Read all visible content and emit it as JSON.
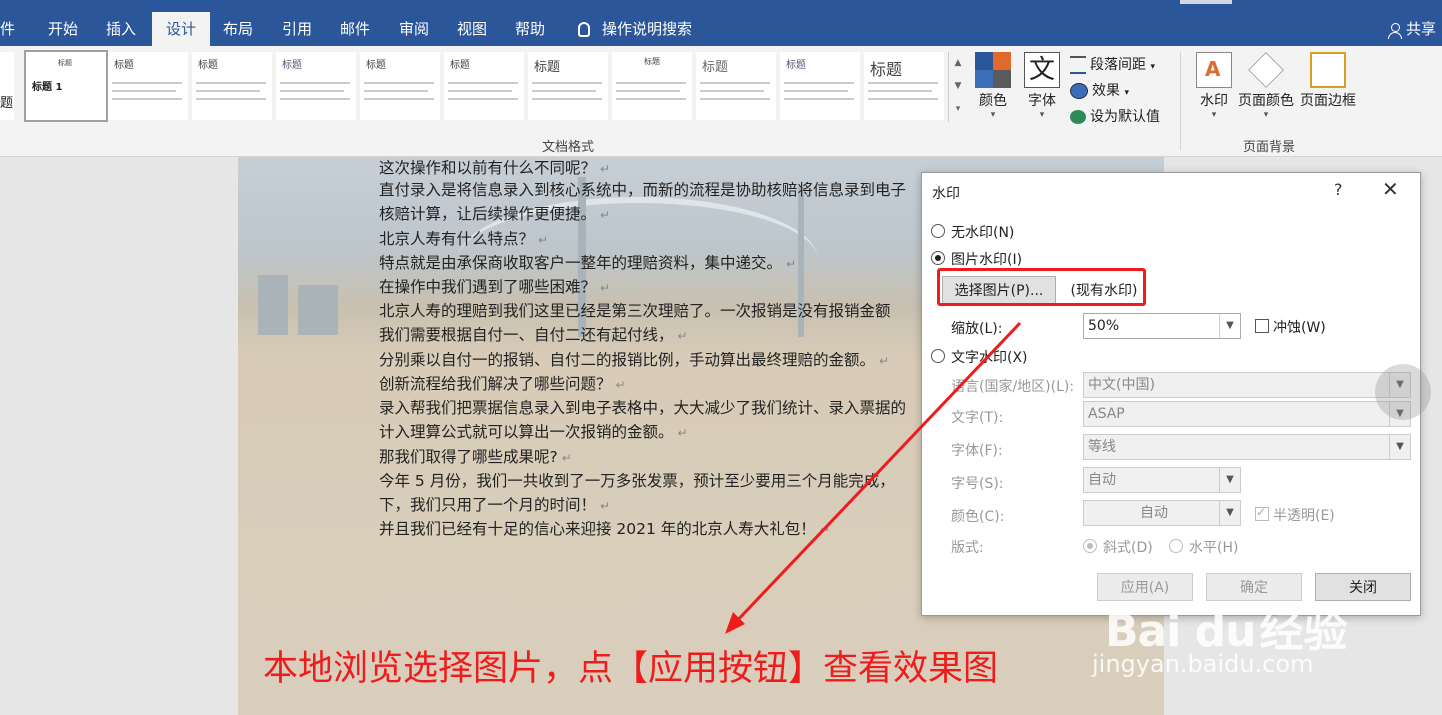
{
  "tabs": {
    "file": "件",
    "home": "开始",
    "insert": "插入",
    "design": "设计",
    "layout": "布局",
    "refs": "引用",
    "mail": "邮件",
    "review": "审阅",
    "view": "视图",
    "help": "帮助",
    "tellme": "操作说明搜索",
    "share": "共享"
  },
  "ribbon": {
    "gallery_partial": "题",
    "gallery_selected_title": "标题 1",
    "gallery_titles": [
      "标题",
      "标题",
      "标题",
      "标题",
      "标题",
      "标题",
      "标题",
      "标题",
      "标题",
      "标题"
    ],
    "group_docformat": "文档格式",
    "colors": "颜色",
    "fonts": "字体",
    "fonts_glyph": "文",
    "para_spacing": "段落间距",
    "effects": "效果",
    "set_default": "设为默认值",
    "watermark": "水印",
    "page_color": "页面颜色",
    "page_border": "页面边框",
    "group_pagebg": "页面背景"
  },
  "document": {
    "lines": [
      "这次操作和以前有什么不同呢？",
      "直付录入是将信息录入到核心系统中，而新的流程是协助核赔将信息录到电子",
      "核赔计算，让后续操作更便捷。",
      "北京人寿有什么特点？",
      "特点就是由承保商收取客户一整年的理赔资料，集中递交。",
      "在操作中我们遇到了哪些困难？",
      "北京人寿的理赔到我们这里已经是第三次理赔了。一次报销是没有报销金额",
      "我们需要根据自付一、自付二还有起付线，",
      "分别乘以自付一的报销、自付二的报销比例，手动算出最终理赔的金额。",
      "创新流程给我们解决了哪些问题？",
      "录入帮我们把票据信息录入到电子表格中，大大减少了我们统计、录入票据的",
      "计入理算公式就可以算出一次报销的金额。",
      "那我们取得了哪些成果呢?",
      "今年  5  月份，我们一共收到了一万多张发票，预计至少要用三个月能完成，",
      "下，我们只用了一个月的时间！",
      "并且我们已经有十足的信心来迎接 2021 年的北京人寿大礼包！"
    ],
    "para_mark": "↵"
  },
  "dialog": {
    "title": "水印",
    "help": "?",
    "close": "✕",
    "no_watermark": "无水印(N)",
    "picture_watermark": "图片水印(I)",
    "select_picture": "选择图片(P)...",
    "existing_watermark": "(现有水印)",
    "scale_label": "缩放(L):",
    "scale_value": "50%",
    "washout": "冲蚀(W)",
    "text_watermark": "文字水印(X)",
    "language_label": "语言(国家/地区)(L):",
    "language_value": "中文(中国)",
    "text_label": "文字(T):",
    "text_value": "ASAP",
    "font_label": "字体(F):",
    "font_value": "等线",
    "size_label": "字号(S):",
    "size_value": "自动",
    "color_label": "颜色(C):",
    "color_value": "自动",
    "semitransparent": "半透明(E)",
    "layout_label": "版式:",
    "diagonal": "斜式(D)",
    "horizontal": "水平(H)",
    "apply": "应用(A)",
    "ok": "确定",
    "close_btn": "关闭"
  },
  "annotation": {
    "caption": "本地浏览选择图片，点【应用按钮】查看效果图",
    "color": "#ee1c1c"
  },
  "watermark": {
    "logo": "Bai du",
    "exp": "经验",
    "url": "jingyan.baidu.com"
  },
  "colors": {
    "ribbon_blue": "#2b579a",
    "accent_red": "#ee1c1c"
  }
}
